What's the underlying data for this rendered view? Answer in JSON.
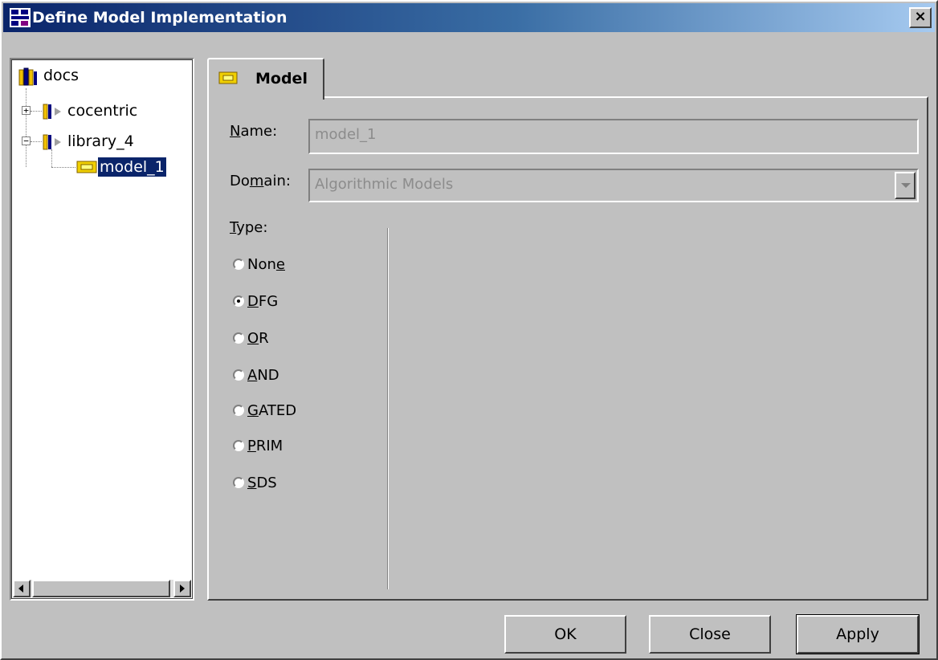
{
  "window": {
    "title": "Define Model Implementation",
    "close_glyph": "×"
  },
  "tree": {
    "root": "docs",
    "items": [
      {
        "label": "cocentric",
        "expander": "+"
      },
      {
        "label": "library_4",
        "expander": "−"
      },
      {
        "label": "model_1",
        "selected": true
      }
    ]
  },
  "tab": {
    "label": "Model"
  },
  "form": {
    "name_label_u": "N",
    "name_label_rest": "ame:",
    "name_value": "model_1",
    "domain_label_a": "Do",
    "domain_label_u": "m",
    "domain_label_b": "ain:",
    "domain_value": "Algorithmic Models",
    "type_label_u": "T",
    "type_label_rest": "ype:",
    "types": [
      {
        "a": "Non",
        "u": "e",
        "b": "",
        "checked": false
      },
      {
        "a": "",
        "u": "D",
        "b": "FG",
        "checked": true
      },
      {
        "a": "",
        "u": "O",
        "b": "R",
        "checked": false
      },
      {
        "a": "",
        "u": "A",
        "b": "ND",
        "checked": false
      },
      {
        "a": "",
        "u": "G",
        "b": "ATED",
        "checked": false
      },
      {
        "a": "",
        "u": "P",
        "b": "RIM",
        "checked": false
      },
      {
        "a": "",
        "u": "S",
        "b": "DS",
        "checked": false
      }
    ]
  },
  "buttons": {
    "ok": "OK",
    "close": "Close",
    "apply": "Apply"
  }
}
